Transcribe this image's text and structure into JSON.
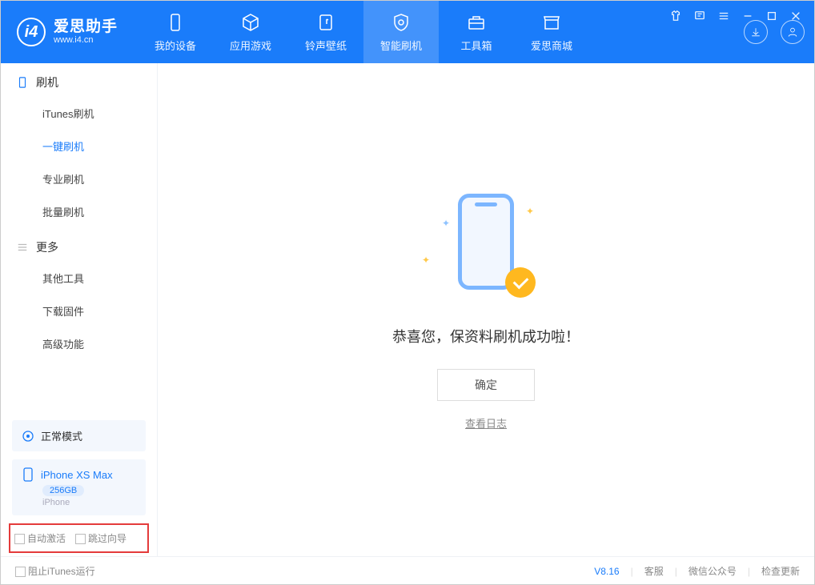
{
  "app": {
    "title": "爱思助手",
    "subtitle": "www.i4.cn"
  },
  "tabs": [
    {
      "label": "我的设备"
    },
    {
      "label": "应用游戏"
    },
    {
      "label": "铃声壁纸"
    },
    {
      "label": "智能刷机"
    },
    {
      "label": "工具箱"
    },
    {
      "label": "爱思商城"
    }
  ],
  "sidebar": {
    "section1": {
      "title": "刷机",
      "items": [
        "iTunes刷机",
        "一键刷机",
        "专业刷机",
        "批量刷机"
      ]
    },
    "section2": {
      "title": "更多",
      "items": [
        "其他工具",
        "下载固件",
        "高级功能"
      ]
    }
  },
  "device": {
    "mode": "正常模式",
    "name": "iPhone XS Max",
    "capacity": "256GB",
    "type": "iPhone"
  },
  "options": {
    "auto_activate": "自动激活",
    "skip_guide": "跳过向导"
  },
  "main": {
    "success": "恭喜您，保资料刷机成功啦！",
    "confirm": "确定",
    "view_log": "查看日志"
  },
  "footer": {
    "block_itunes": "阻止iTunes运行",
    "version": "V8.16",
    "support": "客服",
    "wechat": "微信公众号",
    "update": "检查更新"
  }
}
